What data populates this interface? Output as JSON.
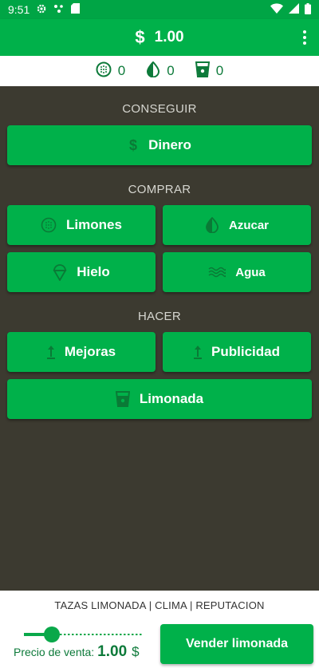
{
  "status_bar": {
    "time": "9:51",
    "icons": [
      "gear-icon",
      "network-dots-icon",
      "sd-card-icon",
      "wifi-icon",
      "signal-icon",
      "battery-icon"
    ]
  },
  "app_bar": {
    "currency_symbol": "$",
    "money": "1.00",
    "menu_icon": "more-vert-icon"
  },
  "inventory": [
    {
      "icon": "lemon-icon",
      "value": "0"
    },
    {
      "icon": "sugar-drop-icon",
      "value": "0"
    },
    {
      "icon": "cup-icon",
      "value": "0"
    }
  ],
  "sections": {
    "get": "CONSEGUIR",
    "buy": "COMPRAR",
    "make": "HACER"
  },
  "buttons": {
    "money": "Dinero",
    "lemons": "Limones",
    "sugar": "Azucar",
    "ice": "Hielo",
    "water": "Agua",
    "upgrades": "Mejoras",
    "advertising": "Publicidad",
    "lemonade": "Limonada"
  },
  "bottom": {
    "headline": "TAZAS LIMONADA | CLIMA | REPUTACION",
    "price_label": "Precio de venta:",
    "price_value": "1.00",
    "price_currency": "$",
    "slider_level": 0.1,
    "sell_button": "Vender limonada"
  },
  "colors": {
    "primary": "#00b14a",
    "status_bar": "#00a545",
    "background": "#3c3a30",
    "accent_text": "#0d7a3a"
  }
}
